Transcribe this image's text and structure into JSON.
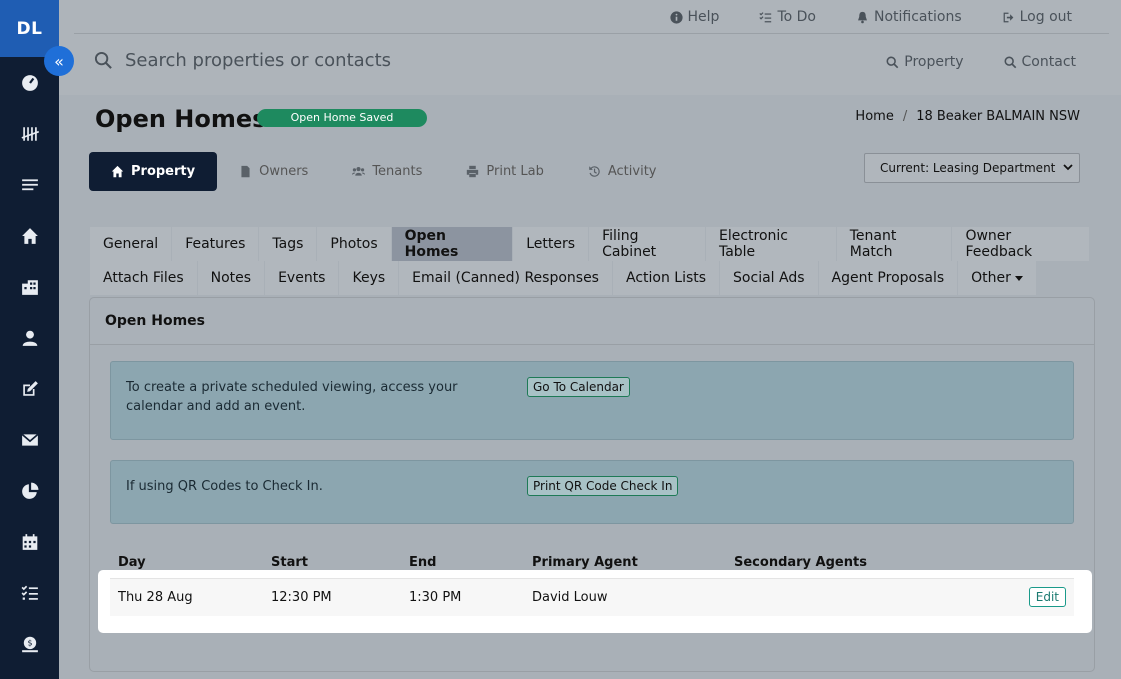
{
  "sidebar": {
    "initials": "DL",
    "collapse_icon": "double-chevron-left-icon",
    "items": [
      {
        "name": "dashboard",
        "icon": "gauge-icon"
      },
      {
        "name": "tally",
        "icon": "tally-icon"
      },
      {
        "name": "list",
        "icon": "list-icon"
      },
      {
        "name": "properties",
        "icon": "home-icon"
      },
      {
        "name": "buildings",
        "icon": "building-icon"
      },
      {
        "name": "contacts",
        "icon": "user-icon"
      },
      {
        "name": "edit",
        "icon": "edit-icon"
      },
      {
        "name": "mail",
        "icon": "envelope-icon"
      },
      {
        "name": "reports",
        "icon": "pie-chart-icon"
      },
      {
        "name": "calendar",
        "icon": "calendar-icon"
      },
      {
        "name": "tasks",
        "icon": "checklist-icon"
      },
      {
        "name": "finance",
        "icon": "money-icon"
      }
    ]
  },
  "topbar": {
    "help": "Help",
    "todo": "To Do",
    "notifications": "Notifications",
    "logout": "Log out",
    "search_placeholder": "Search properties or contacts",
    "search_property": "Property",
    "search_contact": "Contact"
  },
  "header": {
    "title": "Open Homes",
    "badge": "Open Home Saved",
    "breadcrumb": [
      "Home",
      "18 Beaker BALMAIN NSW"
    ],
    "tabs": [
      "Property",
      "Owners",
      "Tenants",
      "Print Lab",
      "Activity"
    ],
    "department": "Current: Leasing Department"
  },
  "subtabs": {
    "row1": [
      "General",
      "Features",
      "Tags",
      "Photos",
      "Open Homes",
      "Letters",
      "Filing Cabinet",
      "Electronic Table",
      "Tenant Match",
      "Owner Feedback"
    ],
    "row2": [
      "Attach Files",
      "Notes",
      "Events",
      "Keys",
      "Email (Canned) Responses",
      "Action Lists",
      "Social Ads",
      "Agent Proposals",
      "Other"
    ]
  },
  "panel": {
    "title": "Open Homes",
    "calendar_text": "To create a private scheduled viewing, access your calendar and add an event.",
    "calendar_button": "Go To Calendar",
    "qr_text": "If using QR Codes to Check In.",
    "qr_button": "Print QR Code Check In"
  },
  "table": {
    "headers": [
      "Day",
      "Start",
      "End",
      "Primary Agent",
      "Secondary Agents"
    ],
    "rows": [
      {
        "day": "Thu 28 Aug",
        "start": "12:30 PM",
        "end": "1:30 PM",
        "primary_agent": "David Louw",
        "secondary_agents": "",
        "action": "Edit"
      }
    ]
  }
}
